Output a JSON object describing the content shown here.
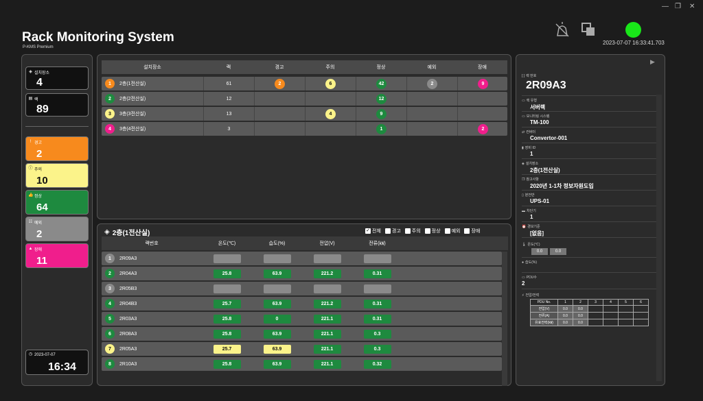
{
  "app": {
    "title": "Rack Monitoring System",
    "subtitle": "P-KMS Premium",
    "datetime": "2023-07-07  16:33:41.703"
  },
  "colors": {
    "warning": "#f78a1d",
    "caution": "#fbf38a",
    "normal": "#1e8a3f",
    "exception": "#8a8a8a",
    "fault": "#f01e8c"
  },
  "summary": {
    "location": {
      "label": "설치장소",
      "value": "4"
    },
    "rack": {
      "label": "랙",
      "value": "89"
    },
    "warning": {
      "label": "경고",
      "value": "2"
    },
    "caution": {
      "label": "주의",
      "value": "10"
    },
    "normal": {
      "label": "정상",
      "value": "64"
    },
    "exception": {
      "label": "예외",
      "value": "2"
    },
    "fault": {
      "label": "장애",
      "value": "11"
    }
  },
  "footer_clock": {
    "date": "2023-07-07",
    "time": "16:34"
  },
  "location_table": {
    "headers": [
      "설치장소",
      "랙",
      "경고",
      "주의",
      "정상",
      "예외",
      "장애"
    ],
    "rows": [
      {
        "n": "1",
        "name": "2층(1전산실)",
        "rack": "61",
        "warn": "2",
        "caution": "6",
        "normal": "42",
        "exc": "2",
        "fault": "9",
        "color": "#f78a1d"
      },
      {
        "n": "2",
        "name": "2층(2전산실)",
        "rack": "12",
        "warn": "",
        "caution": "",
        "normal": "12",
        "exc": "",
        "fault": "",
        "color": "#1e8a3f"
      },
      {
        "n": "3",
        "name": "3층(3전산실)",
        "rack": "13",
        "warn": "",
        "caution": "4",
        "normal": "9",
        "exc": "",
        "fault": "",
        "color": "#fbf38a"
      },
      {
        "n": "4",
        "name": "3층(4전산실)",
        "rack": "3",
        "warn": "",
        "caution": "",
        "normal": "1",
        "exc": "",
        "fault": "2",
        "color": "#f01e8c"
      }
    ]
  },
  "rack_table": {
    "title": "2층(1전산실)",
    "filters": [
      "전체",
      "경고",
      "주의",
      "정상",
      "예외",
      "장애"
    ],
    "headers": [
      "랙번호",
      "온도(℃)",
      "습도(%)",
      "전압(V)",
      "전류(㎾)"
    ],
    "rows": [
      {
        "n": "1",
        "id": "2R09A3",
        "t": "",
        "h": "",
        "v": "",
        "a": "",
        "color": "#8a8a8a"
      },
      {
        "n": "2",
        "id": "2R04A3",
        "t": "25.8",
        "h": "63.9",
        "v": "221.2",
        "a": "0.31",
        "color": "#1e8a3f"
      },
      {
        "n": "3",
        "id": "2R05B3",
        "t": "",
        "h": "",
        "v": "",
        "a": "",
        "color": "#8a8a8a"
      },
      {
        "n": "4",
        "id": "2R04B3",
        "t": "25.7",
        "h": "63.9",
        "v": "221.2",
        "a": "0.31",
        "color": "#1e8a3f"
      },
      {
        "n": "5",
        "id": "2R03A3",
        "t": "25.8",
        "h": "0",
        "v": "221.1",
        "a": "0.31",
        "color": "#1e8a3f"
      },
      {
        "n": "6",
        "id": "2R08A3",
        "t": "25.8",
        "h": "63.9",
        "v": "221.1",
        "a": "0.3",
        "color": "#1e8a3f"
      },
      {
        "n": "7",
        "id": "2R05A3",
        "t": "25.7",
        "h": "63.9",
        "v": "221.1",
        "a": "0.3",
        "color": "#fbf38a"
      },
      {
        "n": "8",
        "id": "2R10A3",
        "t": "25.8",
        "h": "63.9",
        "v": "221.1",
        "a": "0.32",
        "color": "#1e8a3f"
      }
    ]
  },
  "detail": {
    "rack_id_label": "랙 번호",
    "rack_id": "2R09A3",
    "items": [
      {
        "label": "랙 유형",
        "value": "서버랙"
      },
      {
        "label": "모니터링 시스템",
        "value": "TM-100"
      },
      {
        "label": "컨버터",
        "value": "Convertor-001"
      },
      {
        "label": "장비 ID",
        "value": "1"
      },
      {
        "label": "설치장소",
        "value": "2층(1전산실)"
      },
      {
        "label": "참고사항",
        "value": "2020년 1-1차 정보자원도입"
      },
      {
        "label": "분전반",
        "value": "UPS-01"
      },
      {
        "label": "차단기",
        "value": "1"
      },
      {
        "label": "경보기준",
        "value": "[없음]"
      }
    ],
    "temp_label": "온도(℃)",
    "temp_values": [
      "0.0",
      "0.0"
    ],
    "hum_label": "습도(%)",
    "pdu_count_label": "PDU수",
    "pdu_count": "2",
    "power_label": "전압/전력",
    "pdu_table": {
      "headers": [
        "PDU No.",
        "1",
        "2",
        "3",
        "4",
        "5",
        "6"
      ],
      "rows": [
        [
          "전압(V)",
          "0.0",
          "0.0"
        ],
        [
          "전류(A)",
          "0.0",
          "0.0"
        ],
        [
          "유효전력(㎾)",
          "0.0",
          "0.0"
        ]
      ]
    }
  }
}
